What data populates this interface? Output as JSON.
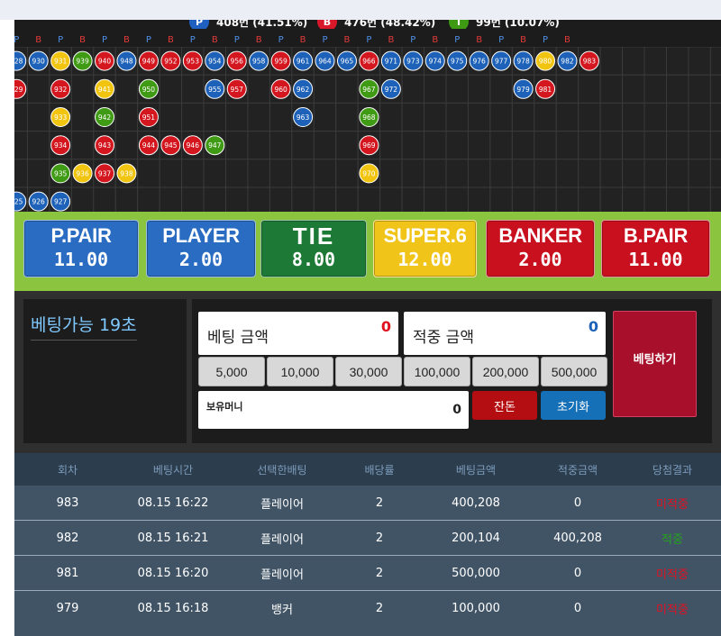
{
  "stats": [
    {
      "key": "P",
      "text": "408번 (41.51%)",
      "color": "#1f5fbf"
    },
    {
      "key": "B",
      "text": "476번 (48.42%)",
      "color": "#d8182a"
    },
    {
      "key": "T",
      "text": "99번 (10.07%)",
      "color": "#3e9a12"
    }
  ],
  "road": {
    "header": [
      "P",
      "B",
      "P",
      "B",
      "P",
      "B",
      "P",
      "B",
      "P",
      "B",
      "P",
      "B",
      "P",
      "B",
      "P",
      "B",
      "P",
      "B",
      "P",
      "B",
      "P",
      "B",
      "P",
      "B",
      "P",
      "B"
    ],
    "colors": {
      "P": "#1d62b8",
      "B": "#d4161f",
      "T": "#3f9a14",
      "S": "#f1c40f"
    },
    "columns": [
      [
        [
          "928",
          "P"
        ],
        [
          "929",
          "B"
        ],
        null,
        null,
        null,
        [
          "925",
          "P"
        ]
      ],
      [
        [
          "930",
          "P"
        ],
        null,
        null,
        null,
        null,
        [
          "926",
          "P"
        ]
      ],
      [
        [
          "931",
          "S"
        ],
        [
          "932",
          "B"
        ],
        [
          "933",
          "S"
        ],
        [
          "934",
          "B"
        ],
        [
          "935",
          "T"
        ],
        [
          "927",
          "P"
        ]
      ],
      [
        [
          "939",
          "T"
        ],
        null,
        null,
        null,
        [
          "936",
          "S"
        ],
        null
      ],
      [
        [
          "940",
          "B"
        ],
        [
          "941",
          "S"
        ],
        [
          "942",
          "T"
        ],
        [
          "943",
          "B"
        ],
        [
          "937",
          "B"
        ],
        null
      ],
      [
        [
          "948",
          "P"
        ],
        null,
        null,
        null,
        [
          "938",
          "S"
        ],
        null
      ],
      [
        [
          "949",
          "B"
        ],
        [
          "950",
          "T"
        ],
        [
          "951",
          "B"
        ],
        [
          "944",
          "B"
        ],
        null,
        null
      ],
      [
        [
          "952",
          "B"
        ],
        null,
        null,
        [
          "945",
          "B"
        ],
        null,
        null
      ],
      [
        [
          "953",
          "B"
        ],
        null,
        null,
        [
          "946",
          "B"
        ],
        null,
        null
      ],
      [
        [
          "954",
          "P"
        ],
        [
          "955",
          "P"
        ],
        null,
        [
          "947",
          "T"
        ],
        null,
        null
      ],
      [
        [
          "956",
          "B"
        ],
        [
          "957",
          "B"
        ],
        null,
        null,
        null,
        null
      ],
      [
        [
          "958",
          "P"
        ],
        null,
        null,
        null,
        null,
        null
      ],
      [
        [
          "959",
          "B"
        ],
        [
          "960",
          "B"
        ],
        null,
        null,
        null,
        null
      ],
      [
        [
          "961",
          "P"
        ],
        [
          "962",
          "P"
        ],
        [
          "963",
          "P"
        ],
        null,
        null,
        null
      ],
      [
        [
          "964",
          "P"
        ],
        null,
        null,
        null,
        null,
        null
      ],
      [
        [
          "965",
          "P"
        ],
        null,
        null,
        null,
        null,
        null
      ],
      [
        [
          "966",
          "B"
        ],
        [
          "967",
          "T"
        ],
        [
          "968",
          "T"
        ],
        [
          "969",
          "B"
        ],
        [
          "970",
          "S"
        ],
        null
      ],
      [
        [
          "971",
          "P"
        ],
        [
          "972",
          "P"
        ],
        null,
        null,
        null,
        null
      ],
      [
        [
          "973",
          "P"
        ],
        null,
        null,
        null,
        null,
        null
      ],
      [
        [
          "974",
          "P"
        ],
        null,
        null,
        null,
        null,
        null
      ],
      [
        [
          "975",
          "P"
        ],
        null,
        null,
        null,
        null,
        null
      ],
      [
        [
          "976",
          "P"
        ],
        null,
        null,
        null,
        null,
        null
      ],
      [
        [
          "977",
          "P"
        ],
        null,
        null,
        null,
        null,
        null
      ],
      [
        [
          "978",
          "P"
        ],
        [
          "979",
          "P"
        ],
        null,
        null,
        null,
        null
      ],
      [
        [
          "980",
          "S"
        ],
        [
          "981",
          "B"
        ],
        null,
        null,
        null,
        null
      ],
      [
        [
          "982",
          "P"
        ],
        null,
        null,
        null,
        null,
        null
      ],
      [
        [
          "983",
          "B"
        ],
        null,
        null,
        null,
        null,
        null
      ]
    ]
  },
  "odds": [
    {
      "name": "P.PAIR",
      "value": "11.00",
      "bg": "#2a6cc2",
      "fg": "#ffffff"
    },
    {
      "name": "PLAYER",
      "value": "2.00",
      "bg": "#2a6cc2",
      "fg": "#ffffff"
    },
    {
      "name": "TIE",
      "value": "8.00",
      "bg": "#1d7a36",
      "fg": "#ffffff"
    },
    {
      "name": "SUPER.6",
      "value": "12.00",
      "bg": "#f0c419",
      "fg": "#ffffff"
    },
    {
      "name": "BANKER",
      "value": "2.00",
      "bg": "#c8101f",
      "fg": "#ffffff"
    },
    {
      "name": "B.PAIR",
      "value": "11.00",
      "bg": "#c8101f",
      "fg": "#ffffff"
    }
  ],
  "panel": {
    "timer": "베팅가능 19초",
    "bet_amount_label": "베팅 금액",
    "bet_amount_value": "0",
    "win_amount_label": "적중 금액",
    "win_amount_value": "0",
    "chips": [
      "5,000",
      "10,000",
      "30,000",
      "100,000",
      "200,000",
      "500,000"
    ],
    "holding_label": "보유머니",
    "holding_value": "0",
    "change_label": "잔돈",
    "reset_label": "초기화",
    "bet_button": "베팅하기"
  },
  "table": {
    "headers": [
      "회차",
      "베팅시간",
      "선택한배팅",
      "배당률",
      "베팅금액",
      "적중금액",
      "당첨결과"
    ],
    "rows": [
      {
        "round": "983",
        "time": "08.15 16:22",
        "choice": "플레이어",
        "odds": "2",
        "bet": "400,208",
        "win": "0",
        "result": "미적중",
        "status": "lose"
      },
      {
        "round": "982",
        "time": "08.15 16:21",
        "choice": "플레이어",
        "odds": "2",
        "bet": "200,104",
        "win": "400,208",
        "result": "적중",
        "status": "win"
      },
      {
        "round": "981",
        "time": "08.15 16:20",
        "choice": "플레이어",
        "odds": "2",
        "bet": "500,000",
        "win": "0",
        "result": "미적중",
        "status": "lose"
      },
      {
        "round": "979",
        "time": "08.15 16:18",
        "choice": "뱅커",
        "odds": "2",
        "bet": "100,000",
        "win": "0",
        "result": "미적중",
        "status": "lose"
      }
    ]
  }
}
